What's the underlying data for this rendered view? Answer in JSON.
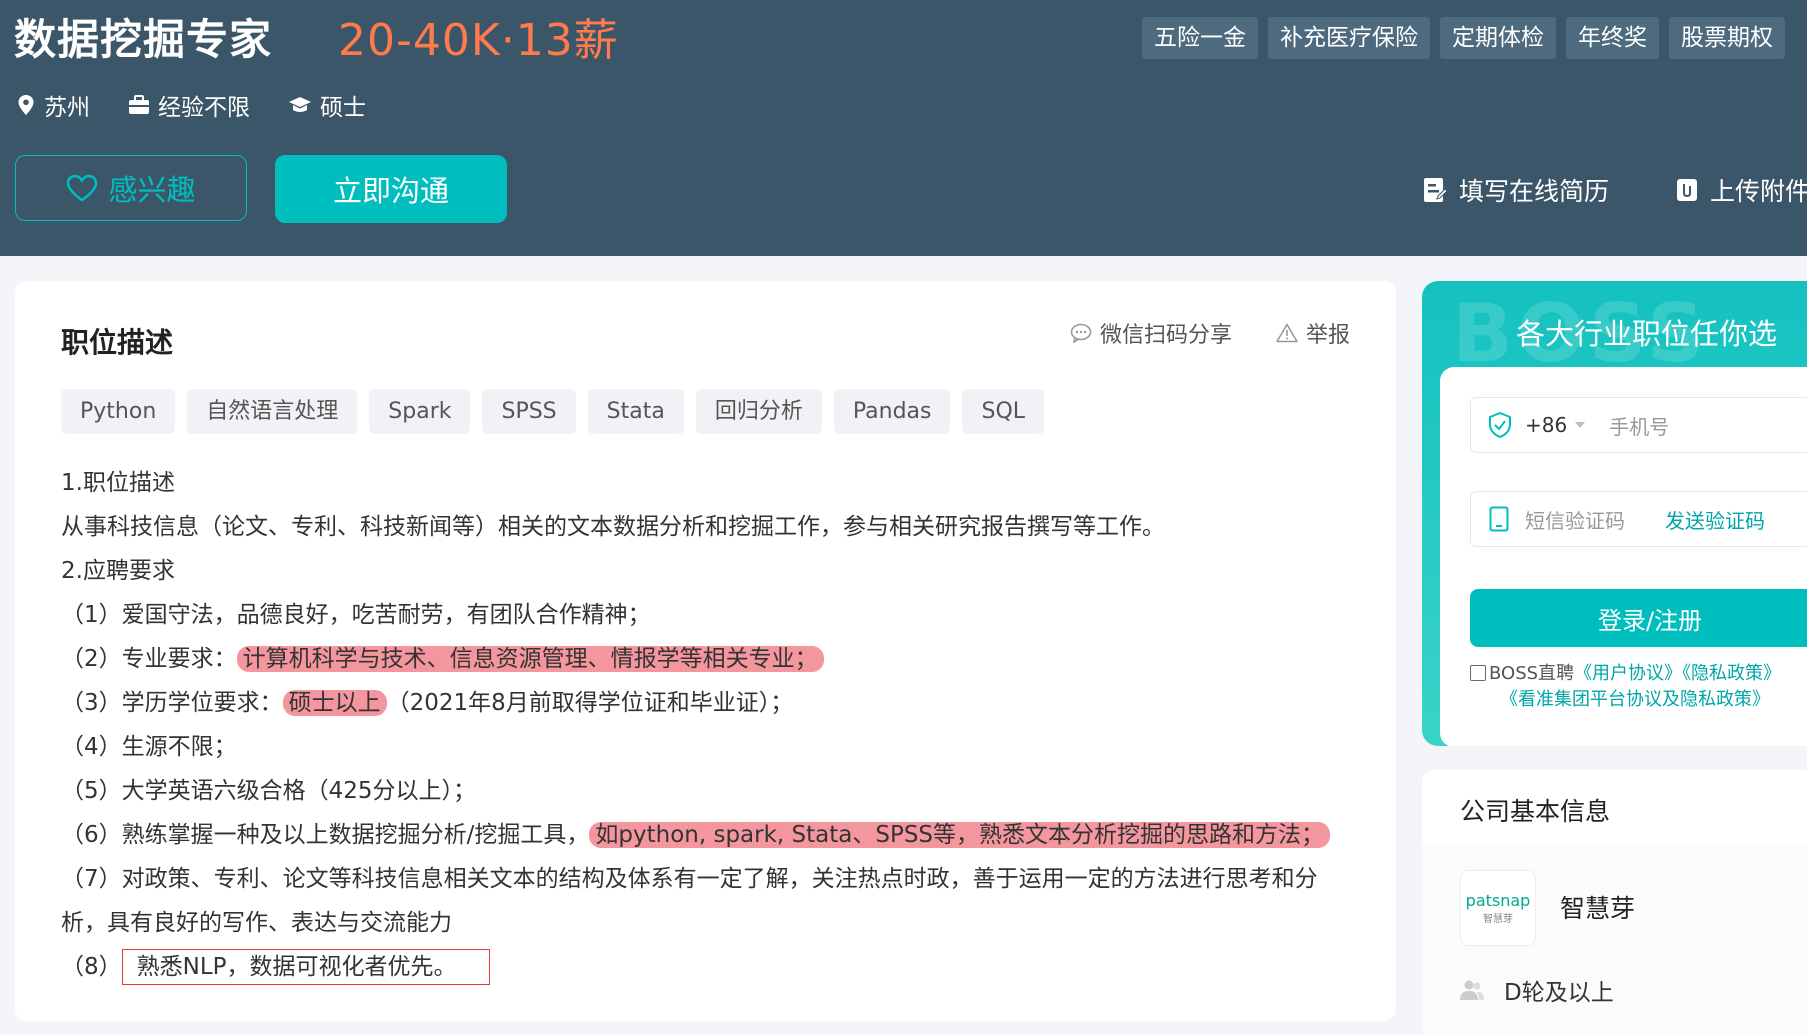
{
  "job": {
    "title": "数据挖掘专家",
    "salary": "20-40K·13薪",
    "benefits": [
      "五险一金",
      "补充医疗保险",
      "定期体检",
      "年终奖",
      "股票期权"
    ],
    "location": "苏州",
    "experience": "经验不限",
    "degree": "硕士"
  },
  "actions": {
    "interest": "感兴趣",
    "chat": "立即沟通",
    "online_resume": "填写在线简历",
    "upload": "上传附件"
  },
  "description": {
    "section_title": "职位描述",
    "share": "微信扫码分享",
    "report": "举报",
    "tags": [
      "Python",
      "自然语言处理",
      "Spark",
      "SPSS",
      "Stata",
      "回归分析",
      "Pandas",
      "SQL"
    ],
    "lines": {
      "l1": "1.职位描述",
      "l2": "从事科技信息（论文、专利、科技新闻等）相关的文本数据分析和挖掘工作，参与相关研究报告撰写等工作。",
      "l3": "2.应聘要求",
      "l4": "（1）爱国守法，品德良好，吃苦耐劳，有团队合作精神；",
      "l5a": "（2）专业要求：",
      "l5b": "计算机科学与技术、信息资源管理、情报学等相关专业；",
      "l6a": "（3）学历学位要求：",
      "l6b": "硕士以上",
      "l6c": "（2021年8月前取得学位证和毕业证）；",
      "l7": "（4）生源不限；",
      "l8": "（5）大学英语六级合格（425分以上）；",
      "l9a": "（6）熟练掌握一种及以上数据挖掘分析/挖掘工具，",
      "l9b": "如python, spark, Stata、SPSS等，熟悉文本分析挖掘的思路和方法；",
      "l10": "（7）对政策、专利、论文等科技信息相关文本的结构及体系有一定了解，关注热点时政，善于运用一定的方法进行思考和分",
      "l11": "析，具有良好的写作、表达与交流能力",
      "l12a": "（8）",
      "l12b": "熟悉NLP，数据可视化者优先。"
    }
  },
  "promo": {
    "watermark": "BOSS",
    "title": "各大行业职位任你选",
    "country_code": "+86",
    "phone_placeholder": "手机号",
    "sms_placeholder": "短信验证码",
    "send_code": "发送验证码",
    "login_button": "登录/注册",
    "agreement_prefix": "BOSS直聘",
    "user_agreement": "《用户协议》",
    "privacy_policy": "《隐私政策》",
    "group_policy": "《看准集团平台协议及隐私政策》"
  },
  "company": {
    "section_title": "公司基本信息",
    "logo_text": "patsnap",
    "logo_sub": "智慧芽",
    "name": "智慧芽",
    "funding": "D轮及以上"
  },
  "colors": {
    "header_bg": "#3c5669",
    "accent": "#00bebd",
    "salary": "#ff7a4c",
    "highlight": "#f06e78"
  }
}
